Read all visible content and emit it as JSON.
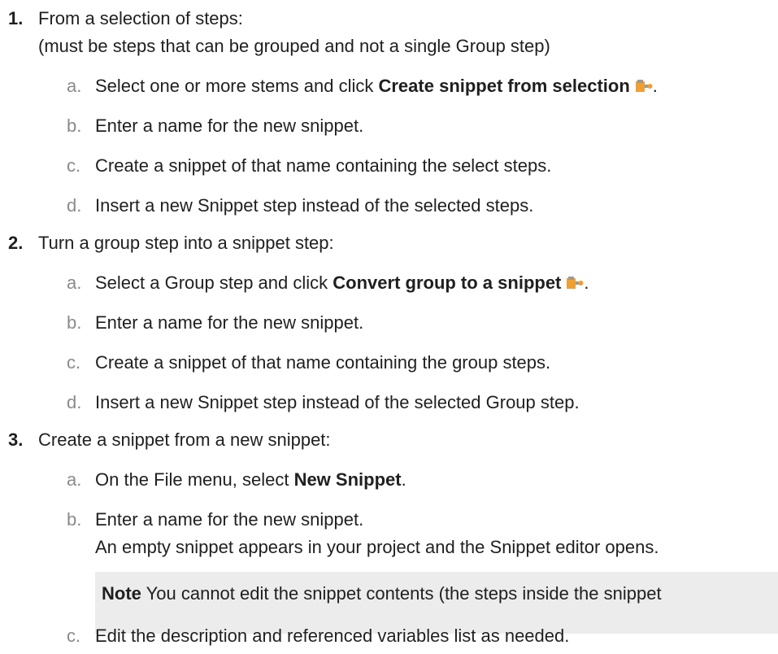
{
  "steps": [
    {
      "num": "1.",
      "text": "From a selection of steps:",
      "subtext": "(must be steps that can be grouped and not a single Group step)",
      "items": [
        {
          "letter": "a.",
          "pre": "Select one or more stems and click ",
          "bold": "Create snippet from selection",
          "icon": "snippet-icon",
          "post": "."
        },
        {
          "letter": "b.",
          "text": "Enter a name for the new snippet."
        },
        {
          "letter": "c.",
          "text": "Create a snippet of that name containing the select steps."
        },
        {
          "letter": "d.",
          "text": "Insert a new Snippet step instead of the selected steps."
        }
      ]
    },
    {
      "num": "2.",
      "text": "Turn a group step into a snippet step:",
      "items": [
        {
          "letter": "a.",
          "pre": "Select a Group step and click ",
          "bold": "Convert group to a snippet",
          "icon": "snippet-icon",
          "post": "."
        },
        {
          "letter": "b.",
          "text": "Enter a name for the new snippet."
        },
        {
          "letter": "c.",
          "text": "Create a snippet of that name containing the group steps."
        },
        {
          "letter": "d.",
          "text": "Insert a new Snippet step instead of the selected Group step."
        }
      ]
    },
    {
      "num": "3.",
      "text": "Create a snippet from a new snippet:",
      "items": [
        {
          "letter": "a.",
          "pre": "On the File menu, select ",
          "bold": "New Snippet",
          "post": "."
        },
        {
          "letter": "b.",
          "text": "Enter a name for the new snippet.",
          "subtext": "An empty snippet appears in your project and the Snippet editor opens."
        },
        {
          "letter": "c.",
          "text": "Edit the description and referenced variables list as needed."
        }
      ]
    }
  ],
  "note": {
    "label": "Note",
    "text": " You cannot edit the snippet contents (the steps inside the snippet"
  },
  "colors": {
    "icon_orange": "#f0a030",
    "icon_gray": "#9a9a9a",
    "note_bg": "#ececec",
    "letter_gray": "#8a8a8a"
  }
}
